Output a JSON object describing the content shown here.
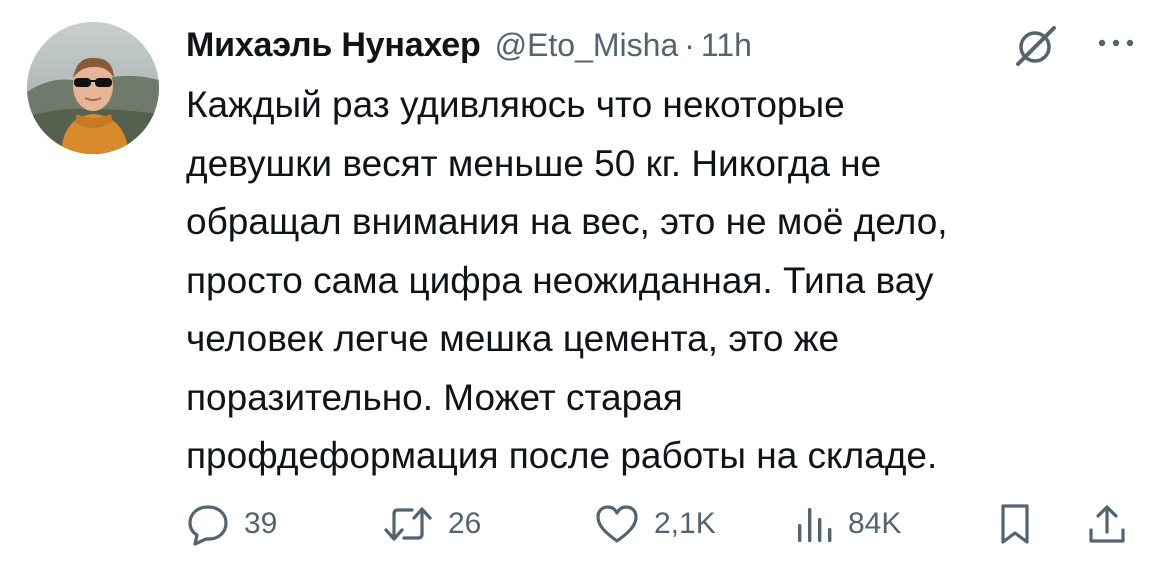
{
  "tweet": {
    "author_name": "Михаэль Нунахер",
    "handle": "@Eto_Misha",
    "separator": "·",
    "time": "11h",
    "text_lines": [
      "Каждый раз удивляюсь что некоторые",
      "девушки весят меньше 50 кг. Никогда не",
      "обращал внимания на вес, это не моё дело,",
      "просто сама цифра неожиданная. Типа вау",
      "человек легче мешка цемента, это же",
      "поразительно. Может старая",
      "профдеформация после работы на складе."
    ]
  },
  "actions": {
    "replies": "39",
    "retweets": "26",
    "likes": "2,1K",
    "views": "84K"
  },
  "icons": {
    "grok": "grok-icon",
    "more": "more-dots-icon",
    "reply": "reply-icon",
    "retweet": "retweet-icon",
    "like": "heart-icon",
    "views": "views-bar-icon",
    "bookmark": "bookmark-icon",
    "share": "share-icon"
  },
  "colors": {
    "text": "#0f1419",
    "secondary": "#536471"
  }
}
